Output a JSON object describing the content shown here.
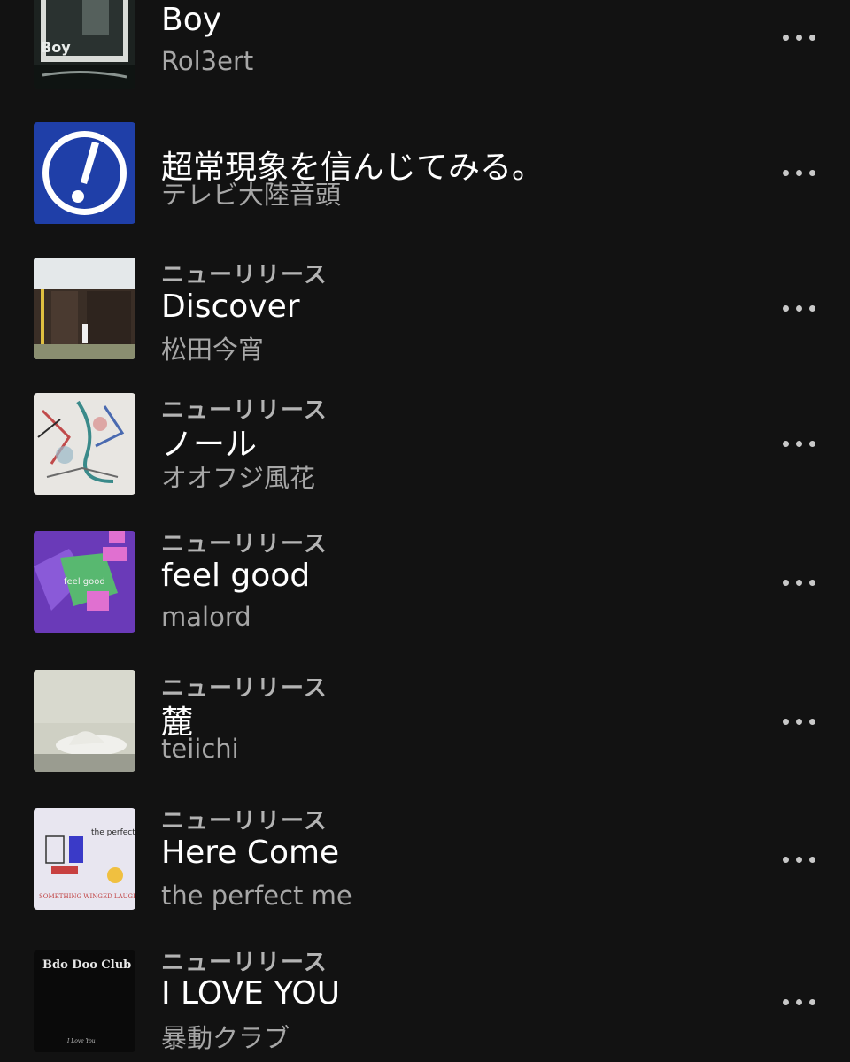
{
  "tracks": [
    {
      "tag": "",
      "title": "Boy",
      "artist": "Rol3ert",
      "art_text": "Boy",
      "art_icon": "album-cover-photo"
    },
    {
      "tag": "",
      "title": "超常現象を信んじてみる。",
      "artist": "テレビ大陸音頭",
      "art_icon": "exclamation-icon",
      "art_color": "#1f3fa8"
    },
    {
      "tag": "ニューリリース",
      "title": "Discover",
      "artist": "松田今宵",
      "art_icon": "album-cover-photo"
    },
    {
      "tag": "ニューリリース",
      "title": "ノール",
      "artist": "オオフジ風花",
      "art_icon": "album-cover-painting"
    },
    {
      "tag": "ニューリリース",
      "title": "feel good",
      "artist": "malord",
      "art_text": "feel good",
      "art_icon": "album-cover-graphic"
    },
    {
      "tag": "ニューリリース",
      "title": "麓",
      "artist": "teiichi",
      "art_icon": "album-cover-photo"
    },
    {
      "tag": "ニューリリース",
      "title": "Here Come",
      "artist": "the perfect me",
      "art_text": "SOMETHING WINGED LAUGHED",
      "art_text2": "the perfect me",
      "art_icon": "album-cover-drawing"
    },
    {
      "tag": "ニューリリース",
      "title": "I LOVE YOU",
      "artist": "暴動クラブ",
      "art_text": "Bdo Doo Club",
      "art_text2": "I Love You",
      "art_icon": "album-cover-dark"
    }
  ],
  "more_icon": "more-options-icon"
}
